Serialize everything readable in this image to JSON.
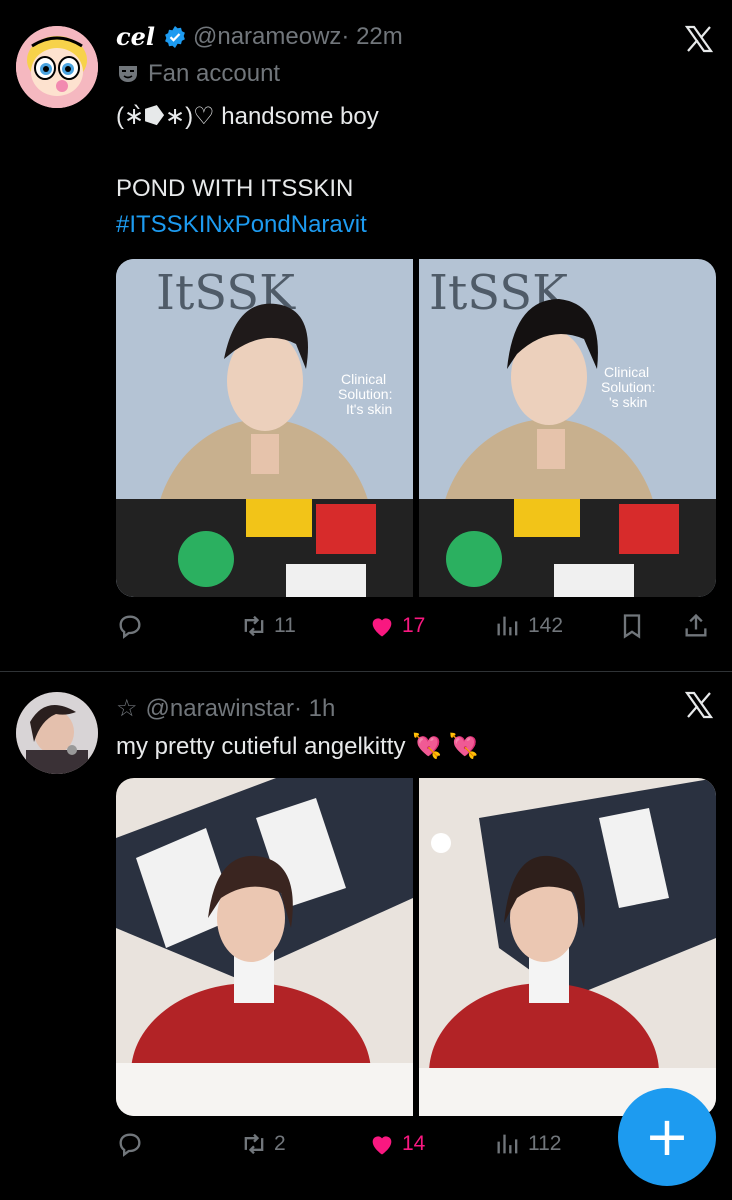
{
  "colors": {
    "accent": "#1d9bf0",
    "like": "#f91880",
    "muted": "#71767b",
    "background": "#000000"
  },
  "tweets": [
    {
      "display_name": "cel",
      "handle": "@narameowz",
      "time": "· 22m",
      "badge_label": "Fan account",
      "text_line1": "(∗̀⭓∗)♡ handsome boy",
      "text_line2": "POND WITH ITSSKIN",
      "hashtag": "#ITSSKINxPondNaravit",
      "reply_count": "",
      "retweet_count": "11",
      "like_count": "17",
      "view_count": "142",
      "icons": [
        "verified-badge-icon",
        "mask-icon",
        "x-logo-icon",
        "reply-icon",
        "retweet-icon",
        "heart-icon",
        "views-icon",
        "bookmark-icon",
        "share-icon"
      ]
    },
    {
      "display_name": "",
      "handle": "@narawinstar",
      "time": "· 1h",
      "star": "☆",
      "text": "my pretty cutieful angelkitty 💘 💘",
      "reply_count": "",
      "retweet_count": "2",
      "like_count": "14",
      "view_count": "112"
    }
  ],
  "fab_label": "+"
}
